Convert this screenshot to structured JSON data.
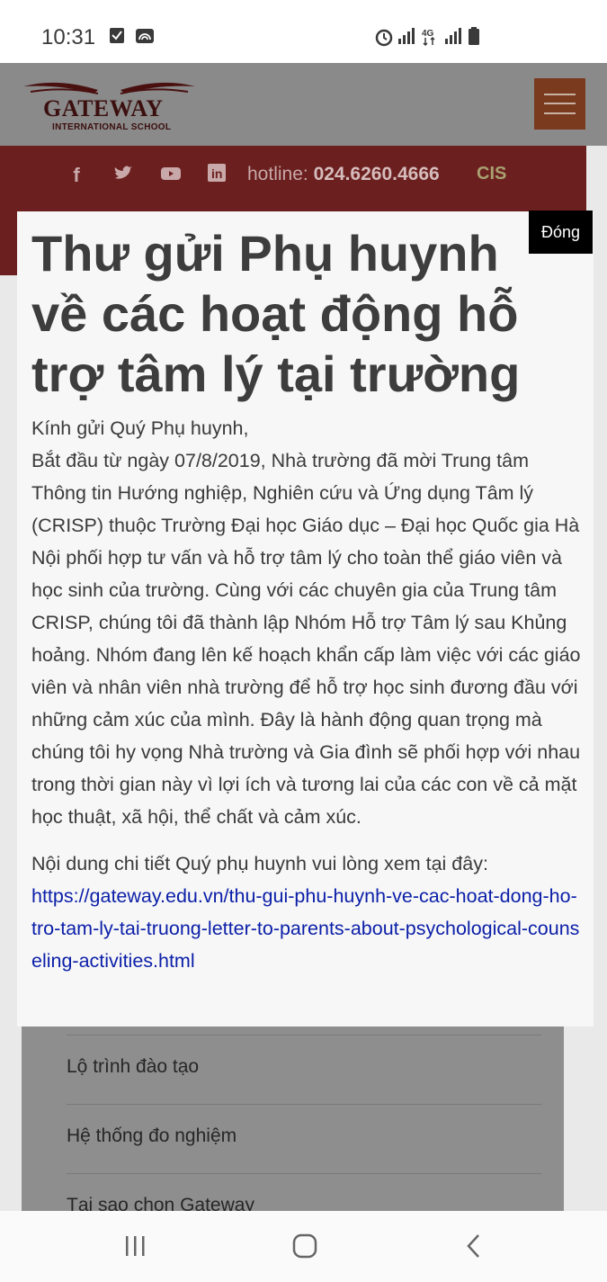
{
  "status_bar": {
    "time": "10:31"
  },
  "site": {
    "logo_name": "GATEWAY",
    "logo_subtitle": "INTERNATIONAL SCHOOL",
    "hotline_label": "hotline:",
    "hotline_number": "024.6260.4666",
    "partner_logo": "CIS",
    "social_icons": [
      "facebook-icon",
      "twitter-icon",
      "youtube-icon",
      "linkedin-icon"
    ]
  },
  "background_menu": {
    "items": [
      "Lộ trình đào tạo",
      "Hệ thống đo nghiệm",
      "Tại sao chọn Gateway"
    ]
  },
  "modal": {
    "close_label": "Đóng",
    "title": "Thư gửi Phụ huynh về các hoạt động hỗ trợ tâm lý tại trường",
    "greeting": "Kính gửi Quý Phụ huynh,",
    "body": "Bắt đầu từ ngày 07/8/2019, Nhà trường đã mời Trung tâm Thông tin Hướng nghiệp, Nghiên cứu và Ứng dụng Tâm lý (CRISP) thuộc Trường Đại học Giáo dục – Đại học Quốc gia Hà Nội phối hợp tư vấn và hỗ trợ tâm lý cho toàn thể giáo viên và học sinh của trường. Cùng với các chuyên gia của Trung tâm CRISP, chúng tôi đã thành lập Nhóm Hỗ trợ Tâm lý sau Khủng hoảng. Nhóm đang lên kế hoạch khẩn cấp làm việc với các giáo viên và nhân viên nhà trường để hỗ trợ học sinh đương đầu với những cảm xúc của mình. Đây là hành động quan trọng mà chúng tôi hy vọng Nhà trường và Gia đình sẽ phối hợp với nhau trong thời gian này vì lợi ích và tương lai của các con về cả mặt học thuật, xã hội, thể chất và cảm xúc.",
    "details_prompt": "Nội dung chi tiết Quý phụ huynh vui lòng xem tại đây:",
    "link": "https://gateway.edu.vn/thu-gui-phu-huynh-ve-cac-hoat-dong-ho-tro-tam-ly-tai-truong-letter-to-parents-about-psychological-counseling-activities.html"
  },
  "colors": {
    "brand_red": "#c0392b",
    "menu_orange": "#e2601f",
    "link_blue": "#0b1fa8"
  }
}
